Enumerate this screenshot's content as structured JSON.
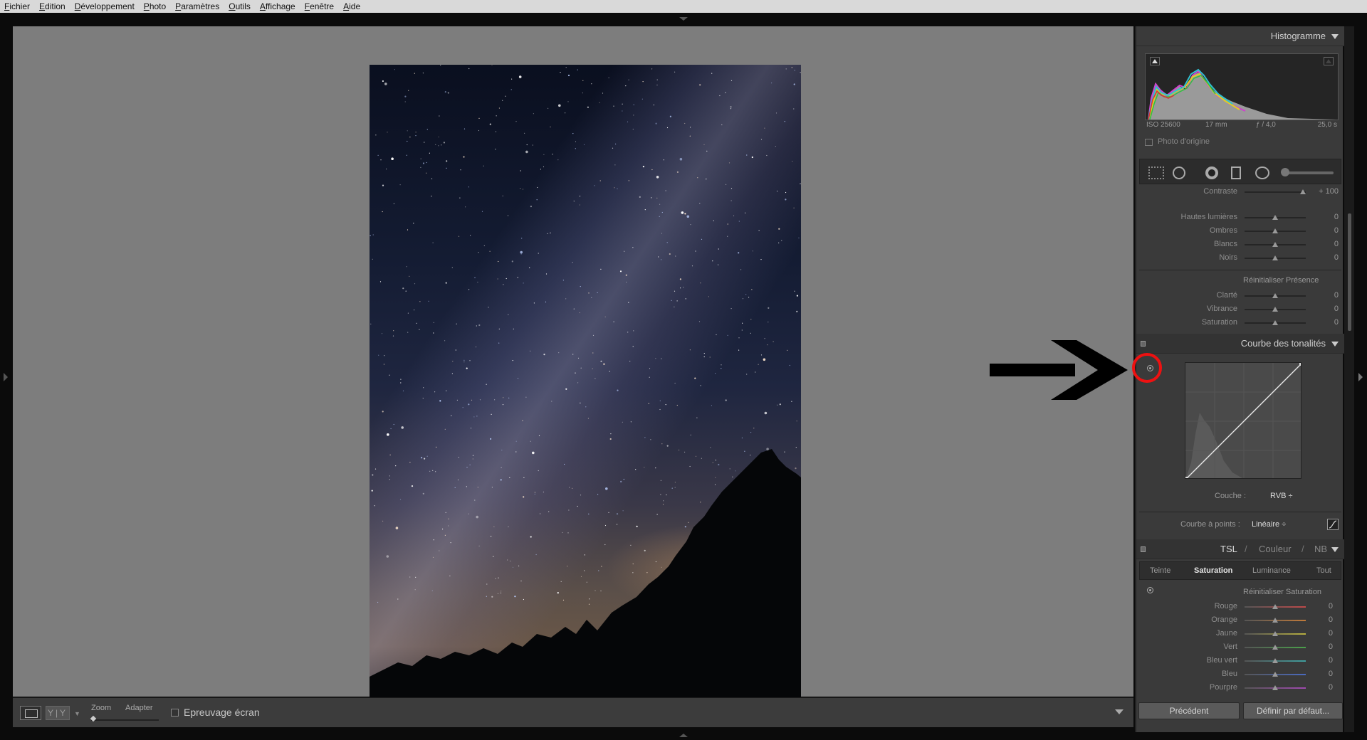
{
  "menu": [
    "Fichier",
    "Edition",
    "Développement",
    "Photo",
    "Paramètres",
    "Outils",
    "Affichage",
    "Fenêtre",
    "Aide"
  ],
  "toolbar": {
    "view_letters": "Y|Y",
    "zoom_label": "Zoom",
    "fit_label": "Adapter",
    "proof_label": "Epreuvage écran"
  },
  "histogram": {
    "title": "Histogramme",
    "iso": "ISO 25600",
    "focal": "17 mm",
    "aperture": "ƒ / 4,0",
    "shutter": "25,0 s",
    "original_label": "Photo d'origine"
  },
  "basic": {
    "contrast": {
      "label": "Contraste",
      "value": "+ 100",
      "level": 0.95
    },
    "tone": [
      {
        "label": "Hautes lumières",
        "value": "0",
        "level": 0.5
      },
      {
        "label": "Ombres",
        "value": "0",
        "level": 0.5
      },
      {
        "label": "Blancs",
        "value": "0",
        "level": 0.5
      },
      {
        "label": "Noirs",
        "value": "0",
        "level": 0.5
      }
    ],
    "presence_reset": "Réinitialiser Présence",
    "presence": [
      {
        "label": "Clarté",
        "value": "0",
        "level": 0.5
      },
      {
        "label": "Vibrance",
        "value": "0",
        "level": 0.5
      },
      {
        "label": "Saturation",
        "value": "0",
        "level": 0.5
      }
    ]
  },
  "tone_curve": {
    "title": "Courbe des tonalités",
    "channel_label": "Couche :",
    "channel_value": "RVB ÷",
    "point_curve_label": "Courbe à points :",
    "point_curve_value": "Linéaire ÷"
  },
  "hsl": {
    "tab_hsl": "TSL",
    "sep1": "/",
    "tab_color": "Couleur",
    "sep2": "/",
    "tab_bw": "NB",
    "subtabs": [
      "Teinte",
      "Saturation",
      "Luminance",
      "Tout"
    ],
    "reset": "Réinitialiser Saturation",
    "colors": [
      {
        "label": "Rouge",
        "value": "0",
        "color": "#c04a4a",
        "level": 0.5
      },
      {
        "label": "Orange",
        "value": "0",
        "color": "#c07a3a",
        "level": 0.5
      },
      {
        "label": "Jaune",
        "value": "0",
        "color": "#b8b040",
        "level": 0.5
      },
      {
        "label": "Vert",
        "value": "0",
        "color": "#4aa04a",
        "level": 0.5
      },
      {
        "label": "Bleu vert",
        "value": "0",
        "color": "#40a0a0",
        "level": 0.5
      },
      {
        "label": "Bleu",
        "value": "0",
        "color": "#4a6ac0",
        "level": 0.5
      },
      {
        "label": "Pourpre",
        "value": "0",
        "color": "#a04ab0",
        "level": 0.5
      }
    ]
  },
  "buttons": {
    "previous": "Précédent",
    "default": "Définir par défaut..."
  },
  "colors": {
    "annotation_red": "#e11111",
    "canvas_gray": "#7d7d7d"
  }
}
